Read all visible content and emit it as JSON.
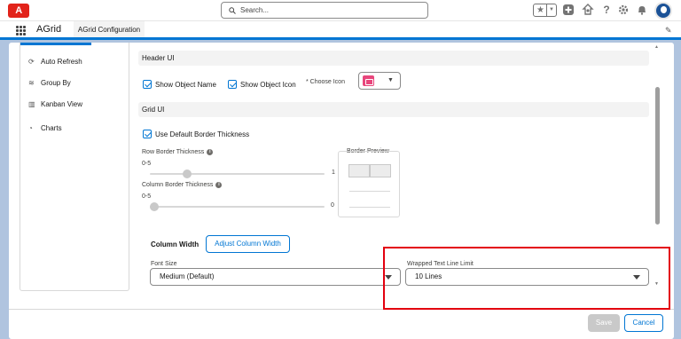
{
  "header": {
    "logo_text": "A",
    "search_placeholder": "Search...",
    "icons": [
      "favorites-star-icon",
      "add-icon",
      "trailhead-icon",
      "help-icon",
      "setup-gear-icon",
      "notifications-bell-icon",
      "avatar"
    ]
  },
  "nav": {
    "app_name": "AGrid",
    "active_tab": "AGrid Configuration"
  },
  "sidebar": {
    "items": [
      {
        "label": "Auto Refresh",
        "icon": "refresh-icon"
      },
      {
        "label": "Group By",
        "icon": "layers-icon"
      },
      {
        "label": "Kanban View",
        "icon": "kanban-icon"
      },
      {
        "label": "Charts",
        "icon": "pie-chart-icon"
      }
    ]
  },
  "header_ui": {
    "title": "Header UI",
    "show_object_name": {
      "label": "Show Object Name",
      "checked": true
    },
    "show_object_icon": {
      "label": "Show Object Icon",
      "checked": true
    },
    "choose_icon_label": "* Choose Icon",
    "choose_icon_color": "#e8467c"
  },
  "grid_ui": {
    "title": "Grid UI",
    "use_default_border": {
      "label": "Use Default Border Thickness",
      "checked": true
    },
    "row_border": {
      "label": "Row Border Thickness",
      "range": "0-5",
      "value": "1",
      "max": 5
    },
    "column_border": {
      "label": "Column Border Thickness",
      "range": "0-5",
      "value": "0",
      "max": 5
    },
    "border_preview_title": "Border Preview"
  },
  "column_width": {
    "label": "Column Width",
    "button": "Adjust Column Width"
  },
  "font_size": {
    "label": "Font Size",
    "value": "Medium (Default)"
  },
  "wrapped_text": {
    "label": "Wrapped Text Line Limit",
    "value": "10 Lines"
  },
  "footer": {
    "save": "Save",
    "cancel": "Cancel"
  },
  "colors": {
    "brand_blue": "#0176d3",
    "highlight_red": "#e3000f"
  }
}
